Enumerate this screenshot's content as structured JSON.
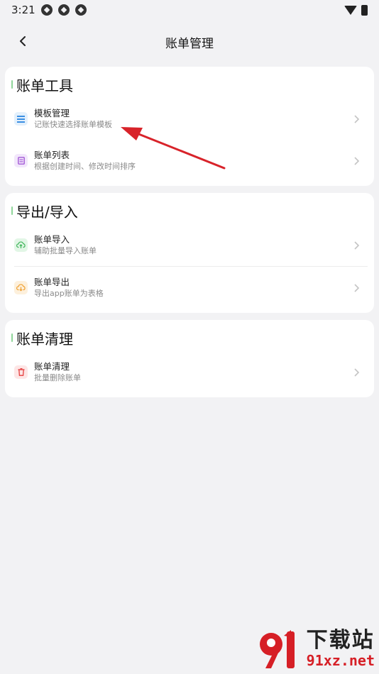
{
  "status_bar": {
    "time": "3:21"
  },
  "nav": {
    "title": "账单管理"
  },
  "sections": [
    {
      "title": "账单工具",
      "items": [
        {
          "title": "模板管理",
          "subtitle": "记账快速选择账单模板",
          "icon": "list-icon",
          "color": "#3b8fe3"
        },
        {
          "title": "账单列表",
          "subtitle": "根据创建时间、修改时间排序",
          "icon": "document-icon",
          "color": "#a35ad6"
        }
      ]
    },
    {
      "title": "导出/导入",
      "items": [
        {
          "title": "账单导入",
          "subtitle": "辅助批量导入账单",
          "icon": "cloud-upload-icon",
          "color": "#3fb55a"
        },
        {
          "title": "账单导出",
          "subtitle": "导出app账单为表格",
          "icon": "cloud-download-icon",
          "color": "#f0a030"
        }
      ]
    },
    {
      "title": "账单清理",
      "items": [
        {
          "title": "账单清理",
          "subtitle": "批量删除账单",
          "icon": "trash-icon",
          "color": "#e53e3e"
        }
      ]
    }
  ],
  "watermark": {
    "line1": "下载站",
    "line2": "91xz.net"
  }
}
